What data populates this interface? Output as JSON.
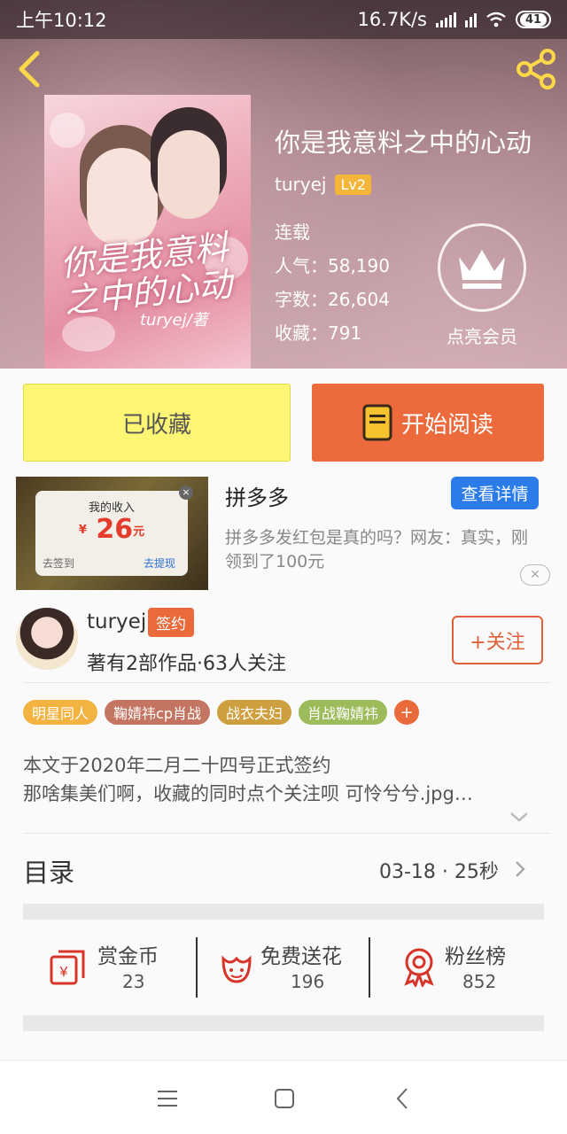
{
  "status_bar": {
    "time": "上午10:12",
    "net_speed": "16.7K/s",
    "battery": "41"
  },
  "book": {
    "title": "你是我意料之中的心动",
    "author": "turyej",
    "level": "Lv2",
    "status": "连载",
    "popularity": "人气：58,190",
    "word_count": "字数：26,604",
    "favorites": "收藏：791",
    "cover_title": "你是我意料之中的心动",
    "cover_author": "turyej/著"
  },
  "vip": {
    "label": "点亮会员"
  },
  "actions": {
    "collected_label": "已收藏",
    "read_label": "开始阅读"
  },
  "ad": {
    "card_title": "我的收入",
    "card_currency": "¥",
    "card_amount": "26",
    "card_unit": "元",
    "card_action_left": "去签到",
    "card_action_right": "去提现",
    "name": "拼多多",
    "button": "查看详情",
    "description": "拼多多发红包是真的吗？网友：真实，刚领到了100元"
  },
  "author_row": {
    "name": "turyej",
    "badge": "签约",
    "stats": "著有2部作品·63人关注",
    "follow": "+关注"
  },
  "tags": [
    {
      "label": "明星同人",
      "color": "#f3b341"
    },
    {
      "label": "鞠婧祎cp肖战",
      "color": "#c47561"
    },
    {
      "label": "战衣夫妇",
      "color": "#cd9f3e"
    },
    {
      "label": "肖战鞠婧祎",
      "color": "#9cbb5b"
    }
  ],
  "intro": {
    "line1": "本文于2020年二月二十四号正式签约",
    "line2": "那啥集美们啊，收藏的同时点个关注呗 可怜兮兮.jpg…"
  },
  "toc": {
    "label": "目录",
    "updated": "03-18 · 25秒"
  },
  "stats": [
    {
      "label": "赏金币",
      "value": "23",
      "icon": "reward-coin-icon"
    },
    {
      "label": "免费送花",
      "value": "196",
      "icon": "flower-icon"
    },
    {
      "label": "粉丝榜",
      "value": "852",
      "icon": "medal-icon"
    }
  ],
  "colors": {
    "accent_orange": "#ec6a3c",
    "collected_yellow": "#fdf574",
    "ad_blue": "#2b7ce9",
    "icon_red": "#d8352a"
  }
}
